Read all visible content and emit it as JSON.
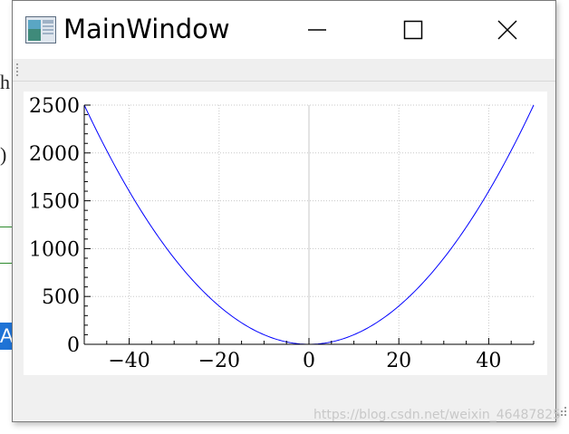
{
  "background": {
    "fragment_top": "h",
    "fragment_mid": ")",
    "fragment_select": "A"
  },
  "window": {
    "title": "MainWindow",
    "icon": "app-window-icon",
    "controls": {
      "minimize": "minimize-icon",
      "maximize": "maximize-icon",
      "close": "close-icon"
    }
  },
  "plot": {
    "xlim": [
      -50,
      50
    ],
    "ylim": [
      0,
      2500
    ],
    "xticks": [
      "−40",
      "−20",
      "0",
      "20",
      "40"
    ],
    "yticks": [
      "0",
      "500",
      "1000",
      "1500",
      "2000",
      "2500"
    ]
  },
  "chart_data": {
    "type": "line",
    "title": "",
    "xlabel": "",
    "ylabel": "",
    "x_range": [
      -50,
      50
    ],
    "y_range": [
      0,
      2500
    ],
    "grid": "dotted",
    "series": [
      {
        "function": "y = x^2",
        "color": "#0000ff",
        "x": [
          -50,
          -40,
          -30,
          -20,
          -10,
          0,
          10,
          20,
          30,
          40,
          50
        ],
        "y": [
          2500,
          1600,
          900,
          400,
          100,
          0,
          100,
          400,
          900,
          1600,
          2500
        ]
      }
    ]
  },
  "watermark": "https://blog.csdn.net/weixin_46487825"
}
